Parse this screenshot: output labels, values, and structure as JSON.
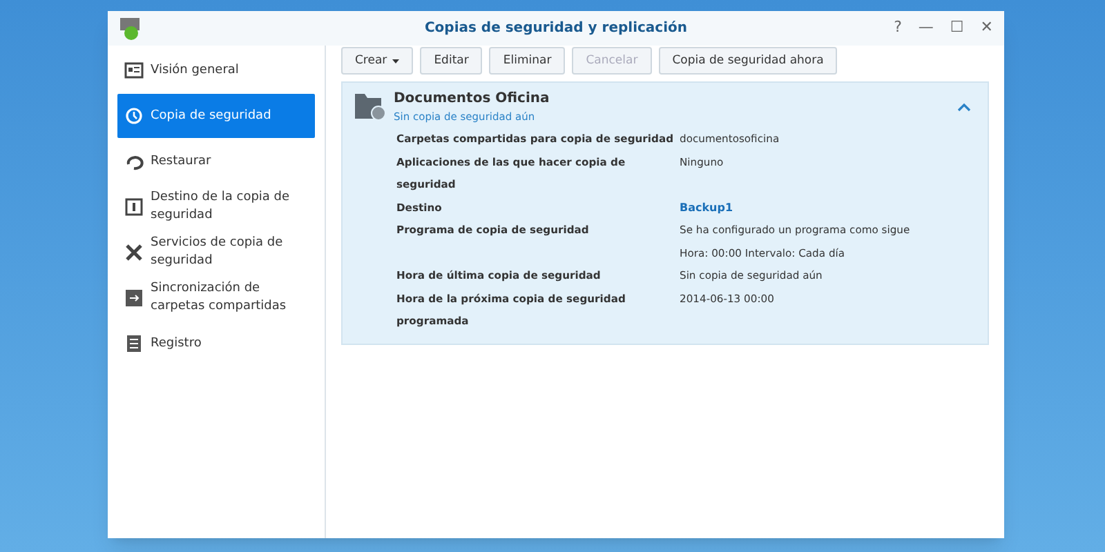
{
  "window": {
    "title": "Copias de seguridad y replicación",
    "controls": [
      "?",
      "—",
      "☐",
      "✕"
    ]
  },
  "sidebar": {
    "items": [
      {
        "label": "Visión general",
        "kind": "overview",
        "selected": false
      },
      {
        "label": "Copia de seguridad",
        "kind": "history",
        "selected": true
      },
      {
        "label": "Restaurar",
        "kind": "restore",
        "selected": false
      },
      {
        "label": "Destino de la copia de seguridad",
        "kind": "target",
        "selected": false
      },
      {
        "label": "Servicios de copia de seguridad",
        "kind": "tools",
        "selected": false
      },
      {
        "label": "Sincronización de carpetas compartidas",
        "kind": "sync",
        "selected": false
      },
      {
        "label": "Registro",
        "kind": "log",
        "selected": false
      }
    ]
  },
  "toolbar": [
    {
      "label": "Crear",
      "dropdown": true,
      "disabled": false
    },
    {
      "label": "Editar",
      "dropdown": false,
      "disabled": false
    },
    {
      "label": "Eliminar",
      "dropdown": false,
      "disabled": false
    },
    {
      "label": "Cancelar",
      "dropdown": false,
      "disabled": true
    },
    {
      "label": "Copia de seguridad ahora",
      "dropdown": false,
      "disabled": false
    }
  ],
  "task": {
    "name": "Documentos Oficina",
    "status": "Sin copia de seguridad aún",
    "expanded": true,
    "details": [
      {
        "label": "Carpetas compartidas para copia de seguridad",
        "values": [
          "documentosoficina"
        ],
        "kind": "text"
      },
      {
        "label": "Aplicaciones de las que hacer copia de seguridad",
        "values": [
          "Ninguno"
        ],
        "kind": "text"
      },
      {
        "label": "Destino",
        "values": [
          "Backup1"
        ],
        "kind": "link"
      },
      {
        "label": "Programa de copia de seguridad",
        "values": [
          "Se ha configurado un programa como sigue",
          "Hora: 00:00 Intervalo: Cada día"
        ],
        "kind": "text"
      },
      {
        "label": "Hora de última copia de seguridad",
        "values": [
          "Sin copia de seguridad aún"
        ],
        "kind": "text"
      },
      {
        "label": "Hora de la próxima copia de seguridad programada",
        "values": [
          "2014-06-13 00:00"
        ],
        "kind": "text"
      }
    ]
  }
}
